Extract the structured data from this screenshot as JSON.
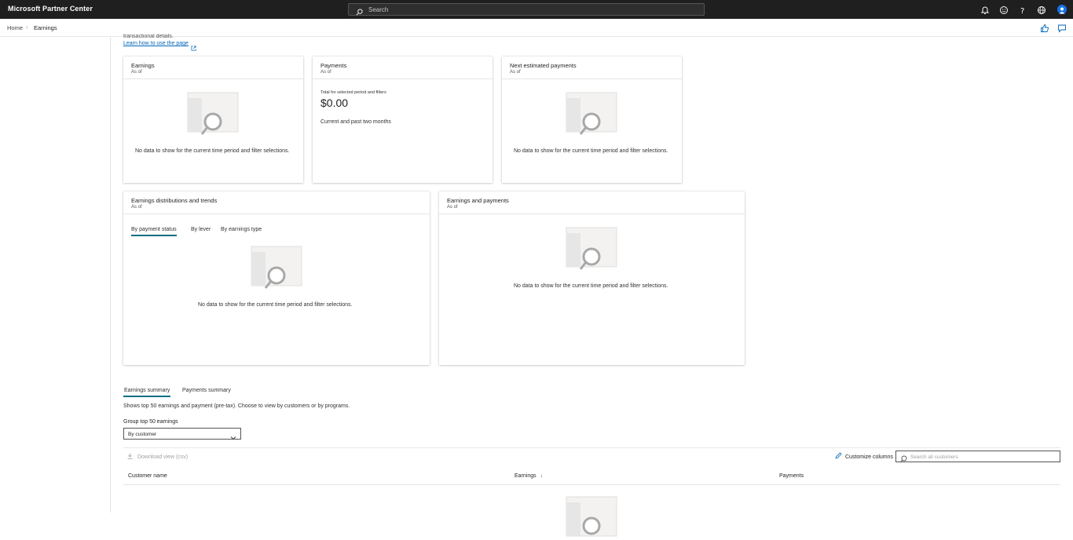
{
  "header": {
    "brand": "Microsoft Partner Center",
    "search_placeholder": "Search"
  },
  "breadcrumb": {
    "home": "Home",
    "current": "Earnings"
  },
  "intro": {
    "cut_text": "transactional details.",
    "learn_link": "Learn how to use the page"
  },
  "cards": {
    "earnings": {
      "title": "Earnings",
      "sub": "As of",
      "empty": "No data to show for the current time period and filter selections."
    },
    "payments": {
      "title": "Payments",
      "sub": "As of",
      "small_label": "Total for selected period and filters",
      "amount": "$0.00",
      "period": "Current and past two months"
    },
    "next_payments": {
      "title": "Next estimated payments",
      "sub": "As of",
      "empty": "No data to show for the current time period and filter selections."
    },
    "distributions": {
      "title": "Earnings distributions and trends",
      "sub": "As of",
      "tabs": [
        "By payment status",
        "By lever",
        "By earnings type"
      ],
      "empty": "No data to show for the current time period and filter selections."
    },
    "earnings_payments": {
      "title": "Earnings and payments",
      "sub": "As of",
      "empty": "No data to show for the current time period and filter selections."
    }
  },
  "summary": {
    "tabs": [
      "Earnings summary",
      "Payments summary"
    ],
    "description": "Shows top 50 earnings and payment (pre-tax). Choose to view by customers or by programs.",
    "group_label": "Group top 50 earnings",
    "group_value": "By customer",
    "download": "Download view (csv)",
    "customize": "Customize columns",
    "search_placeholder": "Search all customers",
    "columns": [
      "Customer name",
      "Earnings",
      "Payments"
    ],
    "sort_arrow": "↓"
  },
  "colors": {
    "topbar": "#1f1f1f",
    "accent": "#0a6e83",
    "link": "#0066b8",
    "avatar": "#1473e6"
  }
}
